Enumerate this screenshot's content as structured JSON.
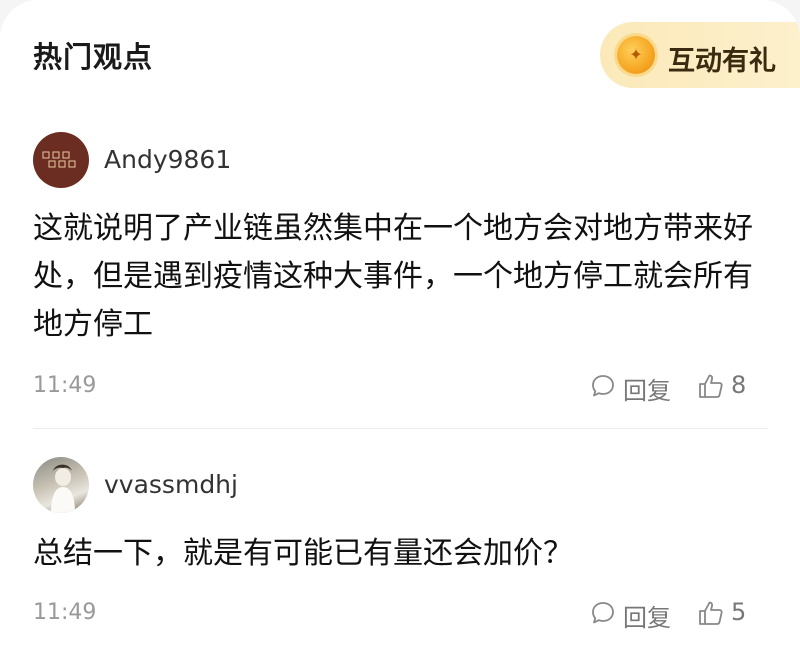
{
  "header": {
    "title": "热门观点",
    "reward_button_label": "互动有礼",
    "reward_icon": "coin-icon"
  },
  "comments": [
    {
      "username": "Andy9861",
      "avatar_icon": "avatar-image",
      "text": "这就说明了产业链虽然集中在一个地方会对地方带来好处，但是遇到疫情这种大事件，一个地方停工就会所有地方停工",
      "time": "11:49",
      "reply_label": "回复",
      "likes": "8"
    },
    {
      "username": "vvassmdhj",
      "avatar_icon": "avatar-image",
      "text": "总结一下，就是有可能已有量还会加价？",
      "time": "11:49",
      "reply_label": "回复",
      "likes": "5"
    }
  ],
  "colors": {
    "accent_reward_bg": "#fbe9b9",
    "coin": "#f6a623",
    "text_primary": "#111111",
    "text_secondary": "#999999"
  }
}
